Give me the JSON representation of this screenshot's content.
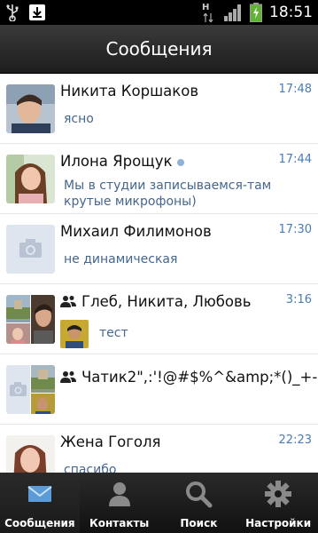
{
  "status_bar": {
    "time": "18:51",
    "network_letter": "H",
    "icons": [
      "usb-icon",
      "download-icon",
      "data-arrows-icon",
      "signal-icon",
      "battery-charging-icon"
    ]
  },
  "header": {
    "title": "Сообщения"
  },
  "conversations": [
    {
      "name": "Никита Коршаков",
      "time": "17:48",
      "preview": "ясно"
    },
    {
      "name": "Илона Ярощук",
      "time": "17:44",
      "preview": "Мы в студии записываемся-там крутые микрофоны)",
      "online": true
    },
    {
      "name": "Михаил Филимонов",
      "time": "17:30",
      "preview": "не динамическая"
    },
    {
      "name": "Глеб, Никита, Любовь",
      "time": "3:16",
      "preview": "тест",
      "group": true
    },
    {
      "name": "Чатик2\",:'!@#$%^&amp;*()_+-...",
      "time": "",
      "preview": "",
      "group": true
    },
    {
      "name": "Жена Гоголя",
      "time": "22:23",
      "preview": "спасибо"
    }
  ],
  "tabs": [
    {
      "label": "Сообщения",
      "icon": "envelope-icon",
      "active": true
    },
    {
      "label": "Контакты",
      "icon": "person-icon",
      "active": false
    },
    {
      "label": "Поиск",
      "icon": "magnifier-icon",
      "active": false
    },
    {
      "label": "Настройки",
      "icon": "gear-icon",
      "active": false
    }
  ],
  "colors": {
    "time": "#4a7bb7",
    "preview": "#45668e",
    "online_dot": "#8fb1d9",
    "header_bg": "#2b2b2b"
  }
}
